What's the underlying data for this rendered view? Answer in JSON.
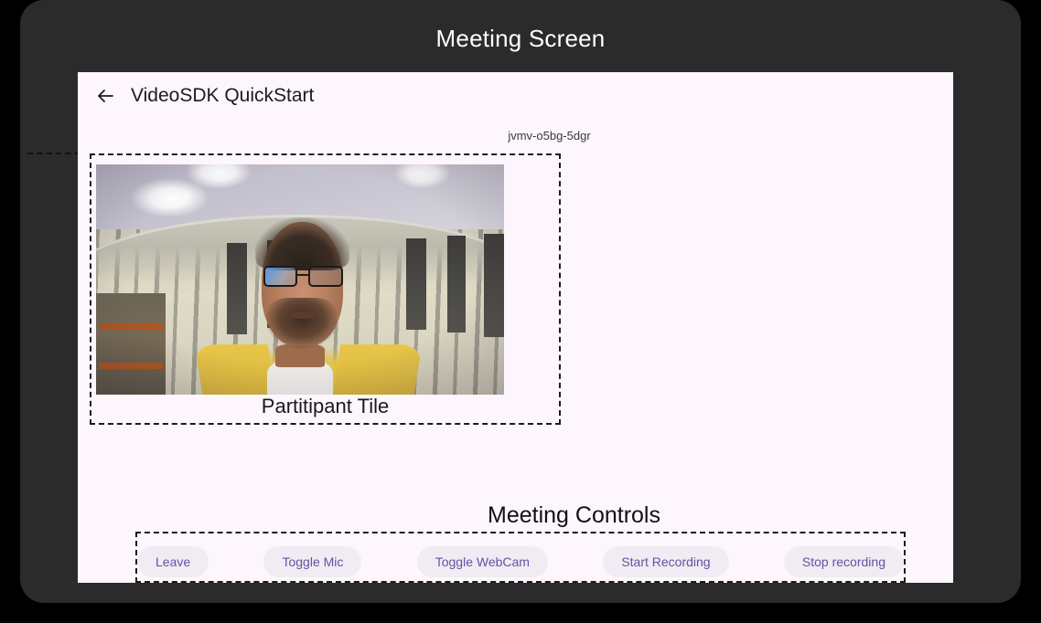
{
  "page": {
    "title": "Meeting Screen",
    "background_color": "#2b2b2b",
    "card_background_color": "#fdf6fd"
  },
  "app_bar": {
    "back_icon": "arrow-left-icon",
    "title": "VideoSDK QuickStart"
  },
  "meeting": {
    "meeting_id": "jvmv-o5bg-5dgr"
  },
  "participant_tile": {
    "caption": "Partitipant Tile",
    "video_description": "live webcam video of a participant"
  },
  "controls": {
    "heading": "Meeting Controls",
    "buttons": [
      {
        "label": "Leave"
      },
      {
        "label": "Toggle Mic"
      },
      {
        "label": "Toggle WebCam"
      },
      {
        "label": "Start Recording"
      },
      {
        "label": "Stop recording"
      }
    ],
    "button_text_color": "#6750a4",
    "button_background_color": "#f0ecf3"
  }
}
